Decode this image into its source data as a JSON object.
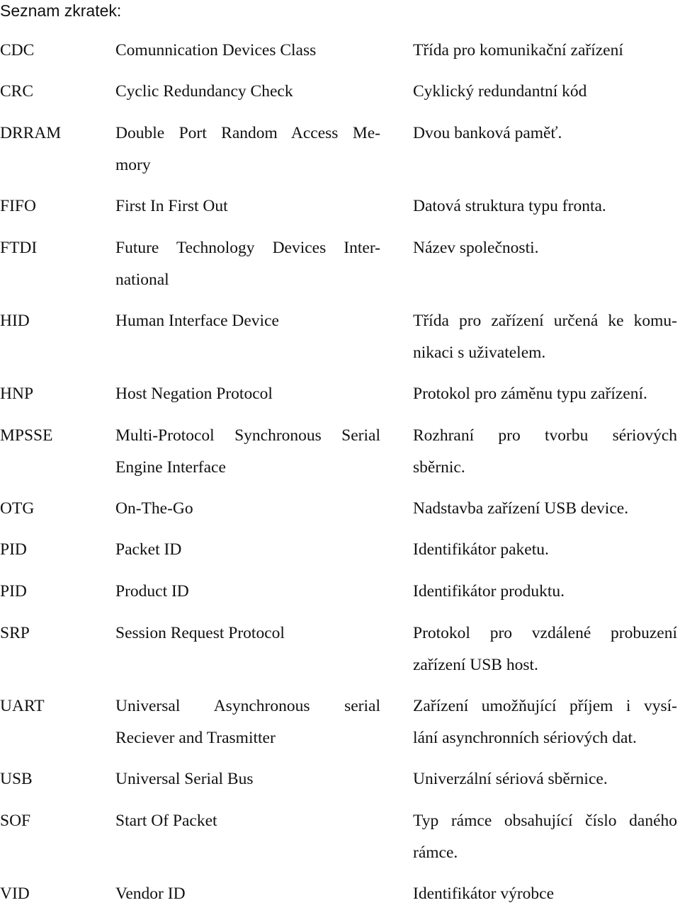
{
  "title": "Seznam zkratek:",
  "rows": [
    {
      "abbr": "CDC",
      "en": [
        "Comunnication Devices Class"
      ],
      "cz": [
        "Třída pro komunikační zařízení"
      ]
    },
    {
      "abbr": "CRC",
      "en": [
        "Cyclic Redundancy Check"
      ],
      "cz": [
        "Cyklický redundantní kód"
      ]
    },
    {
      "abbr": "DRRAM",
      "en": [
        "Double Port Random Access Me-",
        "mory"
      ],
      "cz": [
        "Dvou banková paměť."
      ]
    },
    {
      "abbr": "FIFO",
      "en": [
        "First In First Out"
      ],
      "cz": [
        "Datová struktura typu fronta."
      ]
    },
    {
      "abbr": "FTDI",
      "en": [
        "Future Technology Devices Inter-",
        "national"
      ],
      "cz": [
        "Název společnosti."
      ]
    },
    {
      "abbr": "HID",
      "en": [
        "Human Interface Device"
      ],
      "cz": [
        "Třída pro zařízení určená ke komu-",
        "nikaci s uživatelem."
      ]
    },
    {
      "abbr": "HNP",
      "en": [
        "Host Negation Protocol"
      ],
      "cz": [
        "Protokol pro záměnu typu zařízení."
      ]
    },
    {
      "abbr": "MPSSE",
      "en": [
        "Multi-Protocol Synchronous Serial",
        "Engine Interface"
      ],
      "cz": [
        "Rozhraní pro tvorbu sériových",
        "sběrnic."
      ]
    },
    {
      "abbr": "OTG",
      "en": [
        "On-The-Go"
      ],
      "cz": [
        "Nadstavba zařízení USB device."
      ]
    },
    {
      "abbr": "PID",
      "en": [
        "Packet ID"
      ],
      "cz": [
        "Identifikátor paketu."
      ]
    },
    {
      "abbr": "PID",
      "en": [
        "Product ID"
      ],
      "cz": [
        "Identifikátor produktu."
      ]
    },
    {
      "abbr": "SRP",
      "en": [
        "Session Request Protocol"
      ],
      "cz": [
        "Protokol pro vzdálené probuzení",
        "zařízení USB host."
      ]
    },
    {
      "abbr": "UART",
      "en": [
        "Universal Asynchronous serial",
        "Reciever and Trasmitter"
      ],
      "cz": [
        "Zařízení umožňující příjem i vysí-",
        "lání asynchronních sériových dat."
      ]
    },
    {
      "abbr": "USB",
      "en": [
        "Universal Serial Bus"
      ],
      "cz": [
        "Univerzální sériová sběrnice."
      ]
    },
    {
      "abbr": "SOF",
      "en": [
        "Start Of Packet"
      ],
      "cz": [
        "Typ rámce obsahující číslo daného",
        "rámce."
      ]
    },
    {
      "abbr": "VID",
      "en": [
        "Vendor ID"
      ],
      "cz": [
        "Identifikátor výrobce"
      ]
    }
  ]
}
